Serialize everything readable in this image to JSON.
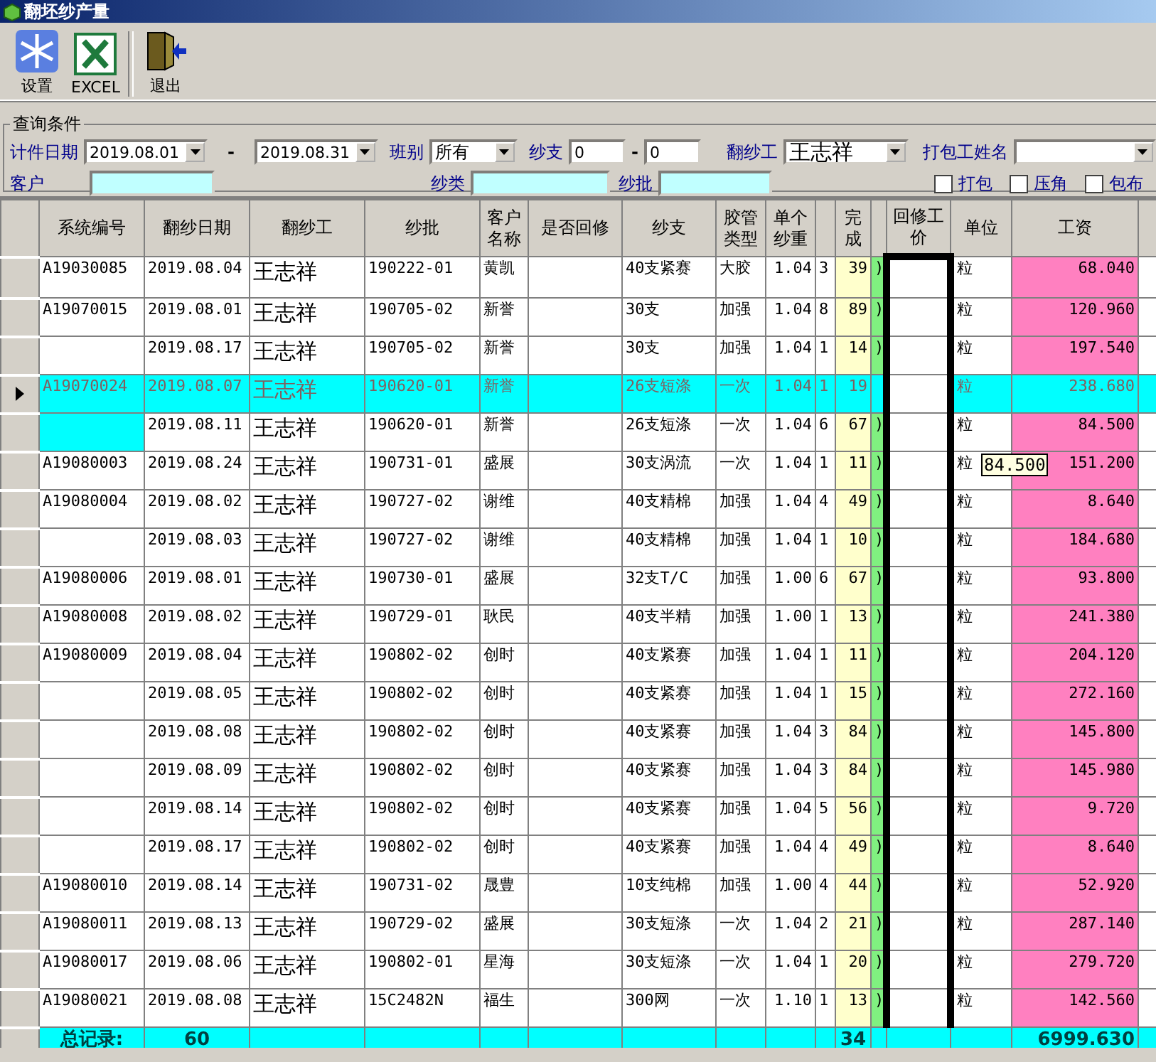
{
  "window": {
    "title": "翻坯纱产量"
  },
  "toolbar": [
    {
      "kind": "settings",
      "label": "设置"
    },
    {
      "kind": "excel",
      "label": "EXCEL"
    },
    {
      "kind": "exit",
      "label": "退出"
    }
  ],
  "query": {
    "title": "查询条件",
    "date_label": "计件日期",
    "date_from": "2019.08.01",
    "date_sep": "-",
    "date_to": "2019.08.31",
    "shift_label": "班别",
    "shift": "所有",
    "count_label": "纱支",
    "count_from": "0",
    "count_sep": "-",
    "count_to": "0",
    "worker_label": "翻纱工",
    "worker": "王志祥",
    "packer_label": "打包工姓名",
    "customer_label": "客户",
    "yarn_type_label": "纱类",
    "batch_label": "纱批",
    "checks": [
      {
        "label": "打包",
        "checked": false
      },
      {
        "label": "压角",
        "checked": false
      },
      {
        "label": "包布",
        "checked": false
      }
    ]
  },
  "table": {
    "columns": [
      {
        "kind": "id",
        "label": "系统编号"
      },
      {
        "kind": "date",
        "label": "翻纱日期"
      },
      {
        "kind": "worker",
        "label": "翻纱工"
      },
      {
        "kind": "batch",
        "label": "纱批"
      },
      {
        "kind": "customer",
        "label": "客户名称"
      },
      {
        "kind": "rework",
        "label": "是否回修"
      },
      {
        "kind": "yarn",
        "label": "纱支"
      },
      {
        "kind": "tube",
        "label": "胶管类型"
      },
      {
        "kind": "weight",
        "label": "单个纱重"
      },
      {
        "kind": "c1"
      },
      {
        "kind": "done",
        "label": "完成"
      },
      {
        "kind": "c2"
      },
      {
        "kind": "price",
        "label": "回修工价"
      },
      {
        "kind": "unit",
        "label": "单位"
      },
      {
        "kind": "wage",
        "label": "工资"
      },
      {
        "kind": "c3"
      }
    ],
    "rows": [
      {
        "id": "A19030085",
        "date": "2019.08.04",
        "worker": "王志祥",
        "batch": "190222-01",
        "customer": "黄凯",
        "yarn": "40支紧赛",
        "tube": "大胶",
        "weight": "1.04",
        "c1": "3",
        "done": "39",
        "c2": ")",
        "unit": "粒",
        "wage": "68.040",
        "selected": false
      },
      {
        "id": "A19070015",
        "date": "2019.08.01",
        "worker": "王志祥",
        "batch": "190705-02",
        "customer": "新誉",
        "yarn": "30支",
        "tube": "加强",
        "weight": "1.04",
        "c1": "8",
        "done": "89",
        "c2": ")",
        "unit": "粒",
        "wage": "120.960",
        "selected": false
      },
      {
        "date": "2019.08.17",
        "worker": "王志祥",
        "batch": "190705-02",
        "customer": "新誉",
        "yarn": "30支",
        "tube": "加强",
        "weight": "1.04",
        "c1": "1",
        "done": "14",
        "c2": ")",
        "unit": "粒",
        "wage": "197.540",
        "selected": false
      },
      {
        "id": "A19070024",
        "date": "2019.08.07",
        "worker": "王志祥",
        "batch": "190620-01",
        "customer": "新誉",
        "yarn": "26支短涤",
        "tube": "一次",
        "weight": "1.04",
        "c1": "1",
        "done": "19",
        "unit": "粒",
        "wage": "238.680",
        "selected": true
      },
      {
        "date": "2019.08.11",
        "worker": "王志祥",
        "batch": "190620-01",
        "customer": "新誉",
        "yarn": "26支短涤",
        "tube": "一次",
        "weight": "1.04",
        "c1": "6",
        "done": "67",
        "c2": ")",
        "unit": "粒",
        "wage": "84.500",
        "selected": false
      },
      {
        "id": "A19080003",
        "date": "2019.08.24",
        "worker": "王志祥",
        "batch": "190731-01",
        "customer": "盛展",
        "yarn": "30支涡流",
        "tube": "一次",
        "weight": "1.04",
        "c1": "1",
        "done": "11",
        "c2": ")",
        "unit": "粒",
        "wage": "151.200",
        "selected": false
      },
      {
        "id": "A19080004",
        "date": "2019.08.02",
        "worker": "王志祥",
        "batch": "190727-02",
        "customer": "谢维",
        "yarn": "40支精棉",
        "tube": "加强",
        "weight": "1.04",
        "c1": "4",
        "done": "49",
        "c2": ")",
        "unit": "粒",
        "wage": "8.640",
        "selected": false
      },
      {
        "date": "2019.08.03",
        "worker": "王志祥",
        "batch": "190727-02",
        "customer": "谢维",
        "yarn": "40支精棉",
        "tube": "加强",
        "weight": "1.04",
        "c1": "1",
        "done": "10",
        "c2": ")",
        "unit": "粒",
        "wage": "184.680",
        "selected": false
      },
      {
        "id": "A19080006",
        "date": "2019.08.01",
        "worker": "王志祥",
        "batch": "190730-01",
        "customer": "盛展",
        "yarn": "32支T/C",
        "tube": "加强",
        "weight": "1.00",
        "c1": "6",
        "done": "67",
        "c2": ")",
        "unit": "粒",
        "wage": "93.800",
        "selected": false
      },
      {
        "id": "A19080008",
        "date": "2019.08.02",
        "worker": "王志祥",
        "batch": "190729-01",
        "customer": "耿民",
        "yarn": "40支半精",
        "tube": "加强",
        "weight": "1.00",
        "c1": "1",
        "done": "13",
        "c2": ")",
        "unit": "粒",
        "wage": "241.380",
        "selected": false
      },
      {
        "id": "A19080009",
        "date": "2019.08.04",
        "worker": "王志祥",
        "batch": "190802-02",
        "customer": "创时",
        "yarn": "40支紧赛",
        "tube": "加强",
        "weight": "1.04",
        "c1": "1",
        "done": "11",
        "c2": ")",
        "unit": "粒",
        "wage": "204.120",
        "selected": false
      },
      {
        "date": "2019.08.05",
        "worker": "王志祥",
        "batch": "190802-02",
        "customer": "创时",
        "yarn": "40支紧赛",
        "tube": "加强",
        "weight": "1.04",
        "c1": "1",
        "done": "15",
        "c2": ")",
        "unit": "粒",
        "wage": "272.160",
        "selected": false
      },
      {
        "date": "2019.08.08",
        "worker": "王志祥",
        "batch": "190802-02",
        "customer": "创时",
        "yarn": "40支紧赛",
        "tube": "加强",
        "weight": "1.04",
        "c1": "3",
        "done": "84",
        "c2": ")",
        "unit": "粒",
        "wage": "145.800",
        "selected": false
      },
      {
        "date": "2019.08.09",
        "worker": "王志祥",
        "batch": "190802-02",
        "customer": "创时",
        "yarn": "40支紧赛",
        "tube": "加强",
        "weight": "1.04",
        "c1": "3",
        "done": "84",
        "c2": ")",
        "unit": "粒",
        "wage": "145.980",
        "selected": false
      },
      {
        "date": "2019.08.14",
        "worker": "王志祥",
        "batch": "190802-02",
        "customer": "创时",
        "yarn": "40支紧赛",
        "tube": "加强",
        "weight": "1.04",
        "c1": "5",
        "done": "56",
        "c2": ")",
        "unit": "粒",
        "wage": "9.720",
        "selected": false
      },
      {
        "date": "2019.08.17",
        "worker": "王志祥",
        "batch": "190802-02",
        "customer": "创时",
        "yarn": "40支紧赛",
        "tube": "加强",
        "weight": "1.04",
        "c1": "4",
        "done": "49",
        "c2": ")",
        "unit": "粒",
        "wage": "8.640",
        "selected": false
      },
      {
        "id": "A19080010",
        "date": "2019.08.14",
        "worker": "王志祥",
        "batch": "190731-02",
        "customer": "晟豊",
        "yarn": "10支纯棉",
        "tube": "加强",
        "weight": "1.00",
        "c1": "4",
        "done": "44",
        "c2": ")",
        "unit": "粒",
        "wage": "52.920",
        "selected": false
      },
      {
        "id": "A19080011",
        "date": "2019.08.13",
        "worker": "王志祥",
        "batch": "190729-02",
        "customer": "盛展",
        "yarn": "30支短涤",
        "tube": "一次",
        "weight": "1.04",
        "c1": "2",
        "done": "21",
        "c2": ")",
        "unit": "粒",
        "wage": "287.140",
        "selected": false
      },
      {
        "id": "A19080017",
        "date": "2019.08.06",
        "worker": "王志祥",
        "batch": "190802-01",
        "customer": "星海",
        "yarn": "30支短涤",
        "tube": "一次",
        "weight": "1.04",
        "c1": "1",
        "done": "20",
        "c2": ")",
        "unit": "粒",
        "wage": "279.720",
        "selected": false
      },
      {
        "id": "A19080021",
        "date": "2019.08.08",
        "worker": "王志祥",
        "batch": "15C2482N",
        "customer": "福生",
        "yarn": "300网",
        "tube": "一次",
        "weight": "1.10",
        "c1": "1",
        "done": "13",
        "c2": ")",
        "unit": "粒",
        "wage": "142.560",
        "selected": false
      }
    ],
    "footer": {
      "label": "总记录:",
      "count": "60",
      "done": "34",
      "wage": "6999.630"
    },
    "tooltip": {
      "text": "84.500"
    }
  }
}
